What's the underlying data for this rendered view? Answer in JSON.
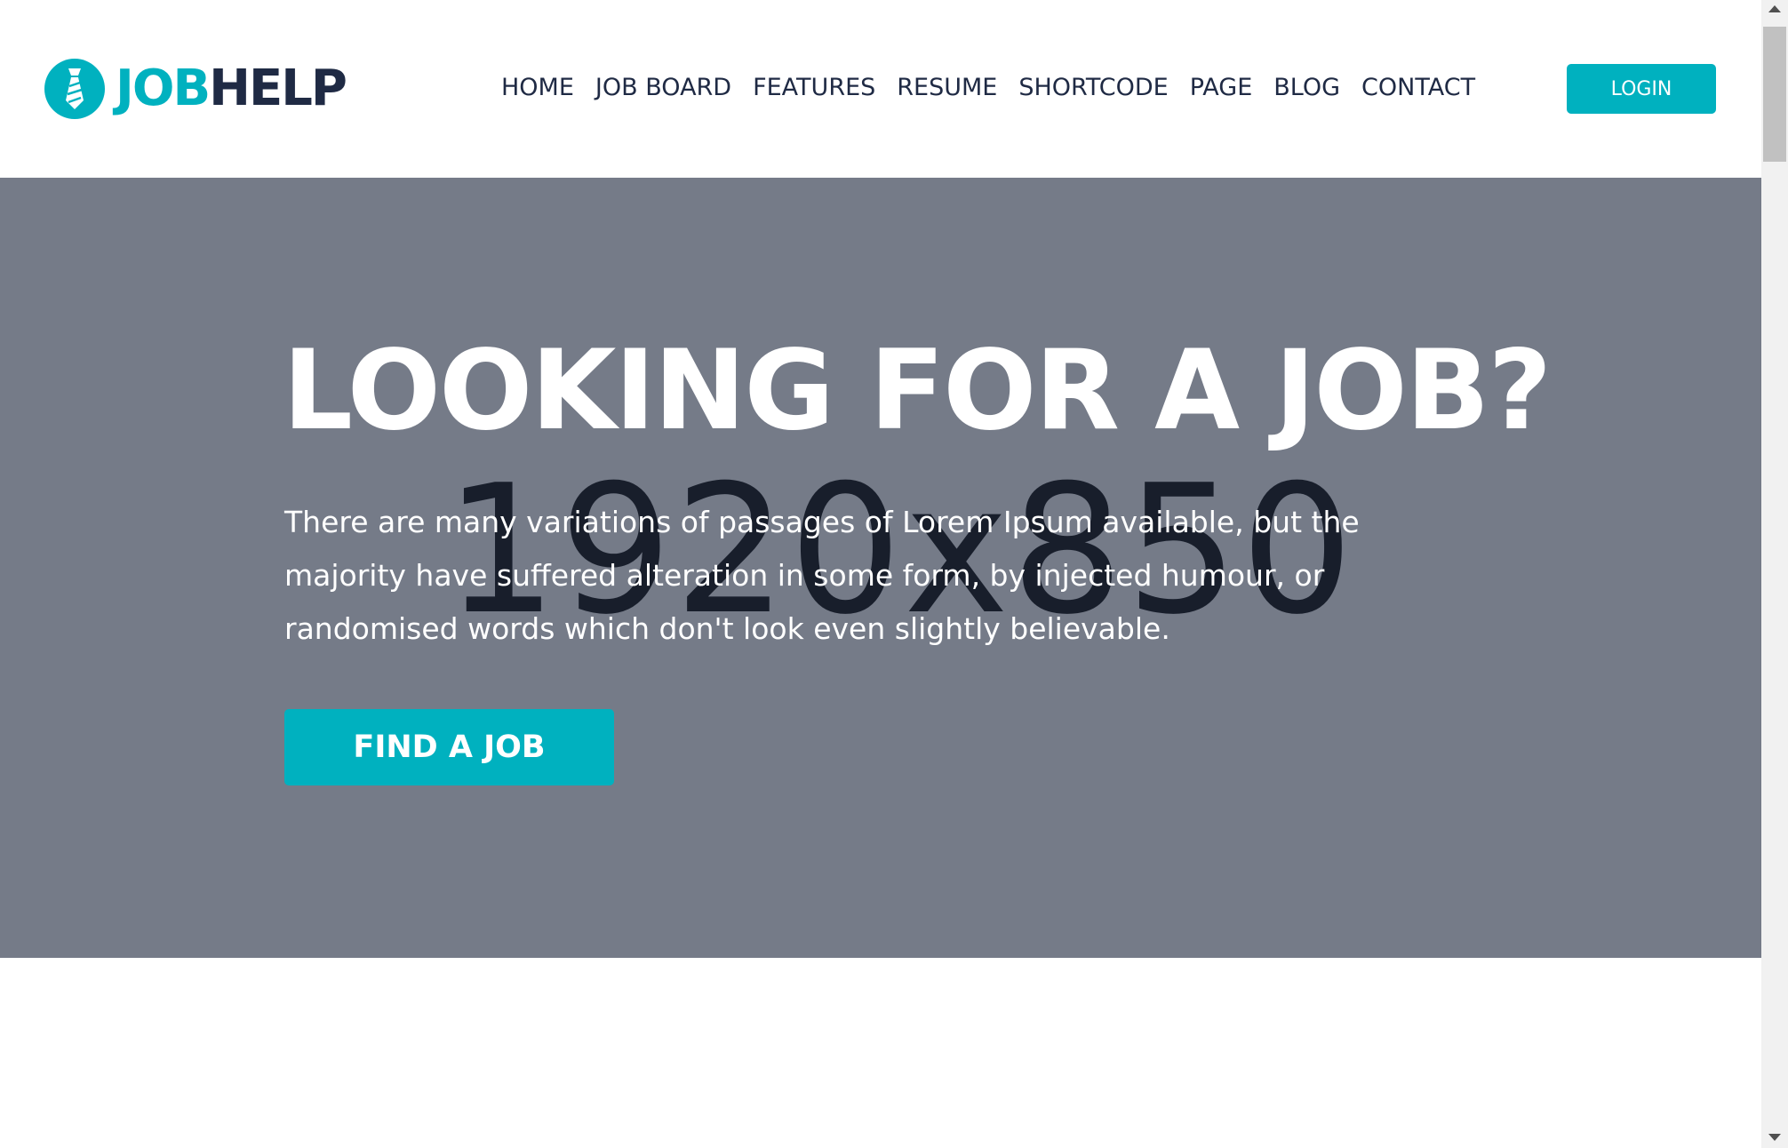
{
  "header": {
    "logo": {
      "icon": "tie-icon",
      "text_part1": "JOB",
      "text_part2": "HELP"
    },
    "nav": [
      {
        "label": "HOME"
      },
      {
        "label": "JOB BOARD"
      },
      {
        "label": "FEATURES"
      },
      {
        "label": "RESUME"
      },
      {
        "label": "SHORTCODE"
      },
      {
        "label": "PAGE"
      },
      {
        "label": "BLOG"
      },
      {
        "label": "CONTACT"
      }
    ],
    "login_label": "LOGIN"
  },
  "hero": {
    "placeholder_label": "1920x850",
    "title": "LOOKING FOR A JOB?",
    "text": "There are many variations of passages of Lorem Ipsum available, but the majority have suffered alteration in some form, by injected humour, or randomised words which don't look even slightly believable.",
    "cta_label": "FIND A JOB"
  },
  "colors": {
    "accent": "#00b1bf",
    "dark": "#1f2a44",
    "hero_bg": "#757b88"
  }
}
